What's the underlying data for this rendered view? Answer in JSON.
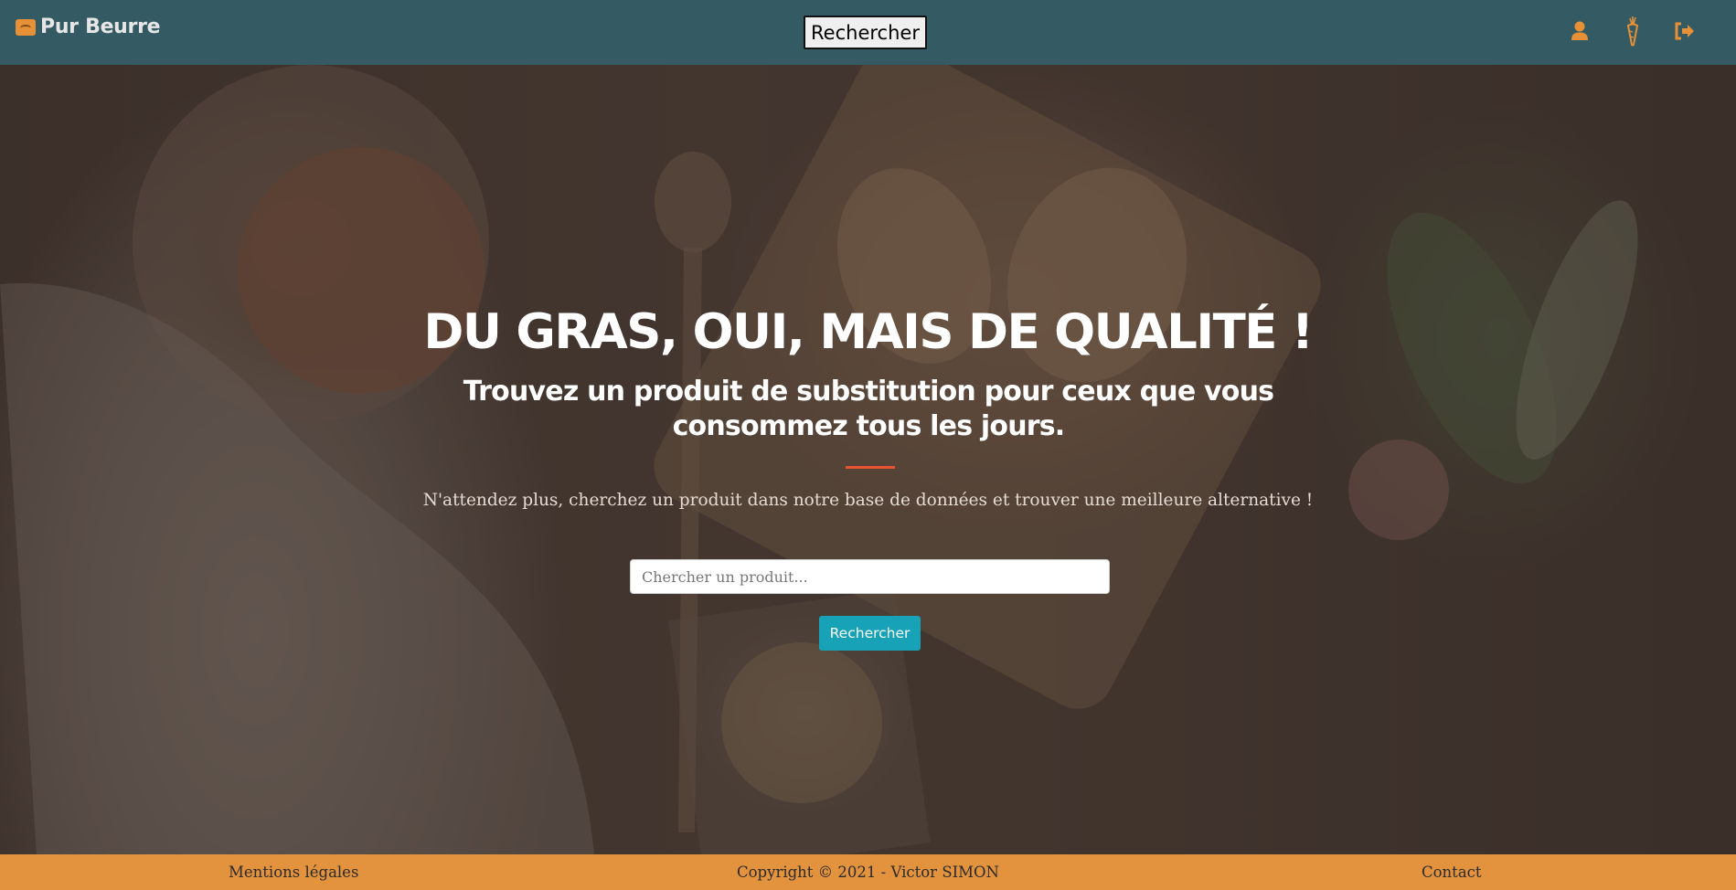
{
  "nav": {
    "brand": "Pur Beurre",
    "search_button": "Rechercher",
    "icons": {
      "user": "user-icon",
      "carrot": "carrot-icon",
      "logout": "sign-out-icon"
    },
    "icon_color": "#e69138"
  },
  "hero": {
    "title": "DU GRAS, OUI, MAIS DE QUALITÉ !",
    "subtitle": "Trouvez un produit de substitution pour ceux que vous consommez tous les jours.",
    "lead": "N'attendez plus, cherchez un produit dans notre base de données et trouver une meilleure alternative !",
    "search_placeholder": "Chercher un produit...",
    "search_value": "",
    "search_button": "Rechercher",
    "accent_color": "#e8542f",
    "button_color": "#17a2b8"
  },
  "footer": {
    "legal": "Mentions légales",
    "copyright": "Copyright © 2021 - Victor SIMON",
    "contact": "Contact",
    "background": "#e3923e"
  },
  "colors": {
    "navbar": "#345b63"
  }
}
